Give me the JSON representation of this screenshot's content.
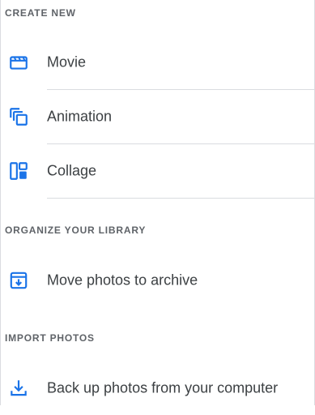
{
  "accent_color": "#1a73e8",
  "sections": [
    {
      "header": "CREATE NEW",
      "items": [
        {
          "label": "Movie",
          "icon": "movie-clapperboard-icon"
        },
        {
          "label": "Animation",
          "icon": "animation-stacked-squares-icon"
        },
        {
          "label": "Collage",
          "icon": "collage-panels-icon"
        }
      ]
    },
    {
      "header": "ORGANIZE YOUR LIBRARY",
      "items": [
        {
          "label": "Move photos to archive",
          "icon": "archive-box-icon"
        }
      ]
    },
    {
      "header": "IMPORT PHOTOS",
      "items": [
        {
          "label": "Back up photos from your computer",
          "icon": "download-tray-icon"
        }
      ]
    }
  ]
}
